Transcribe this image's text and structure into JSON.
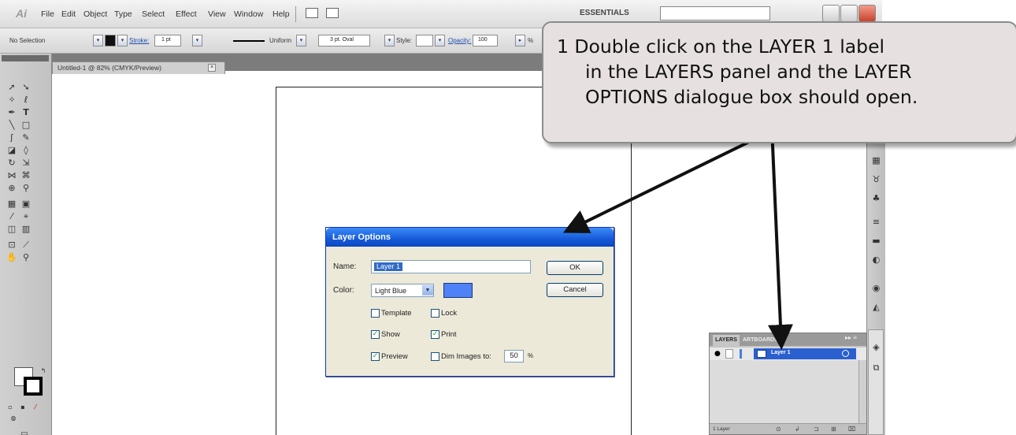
{
  "menubar": {
    "app_logo": "Ai",
    "items": [
      "File",
      "Edit",
      "Object",
      "Type",
      "Select",
      "Effect",
      "View",
      "Window",
      "Help"
    ],
    "workspace": "ESSENTIALS"
  },
  "control_bar": {
    "selection": "No Selection",
    "stroke_label": "Stroke:",
    "stroke_weight": "1 pt",
    "profile": "Uniform",
    "brush": "3 pt. Oval",
    "style_label": "Style:",
    "opacity_label": "Opacity:",
    "opacity_value": "100",
    "opacity_unit": "%"
  },
  "document_tab": {
    "title": "Untitled-1 @ 82% (CMYK/Preview)",
    "close": "×"
  },
  "layer_options_dialog": {
    "title": "Layer Options",
    "name_label": "Name:",
    "name_value": "Layer 1",
    "color_label": "Color:",
    "color_value": "Light Blue",
    "color_swatch": "#4f81f7",
    "ok_label": "OK",
    "cancel_label": "Cancel",
    "checkboxes": {
      "template": {
        "label": "Template",
        "checked": false
      },
      "lock": {
        "label": "Lock",
        "checked": false
      },
      "show": {
        "label": "Show",
        "checked": true
      },
      "print": {
        "label": "Print",
        "checked": true
      },
      "preview": {
        "label": "Preview",
        "checked": true
      },
      "dim_images": {
        "label": "Dim Images to:",
        "checked": false
      }
    },
    "dim_value": "50",
    "dim_unit": "%"
  },
  "layers_panel": {
    "tab_layers": "LAYERS",
    "tab_artboards": "ARTBOARDS",
    "menu": "▸▸ ≡",
    "layer_name": "Layer 1",
    "layer_count": "1 Layer",
    "selection_color": "#2a5fcf"
  },
  "callout": {
    "lines": [
      "1  Double click on the LAYER 1 label",
      "in the LAYERS panel and the LAYER",
      "OPTIONS dialogue box should open."
    ]
  }
}
